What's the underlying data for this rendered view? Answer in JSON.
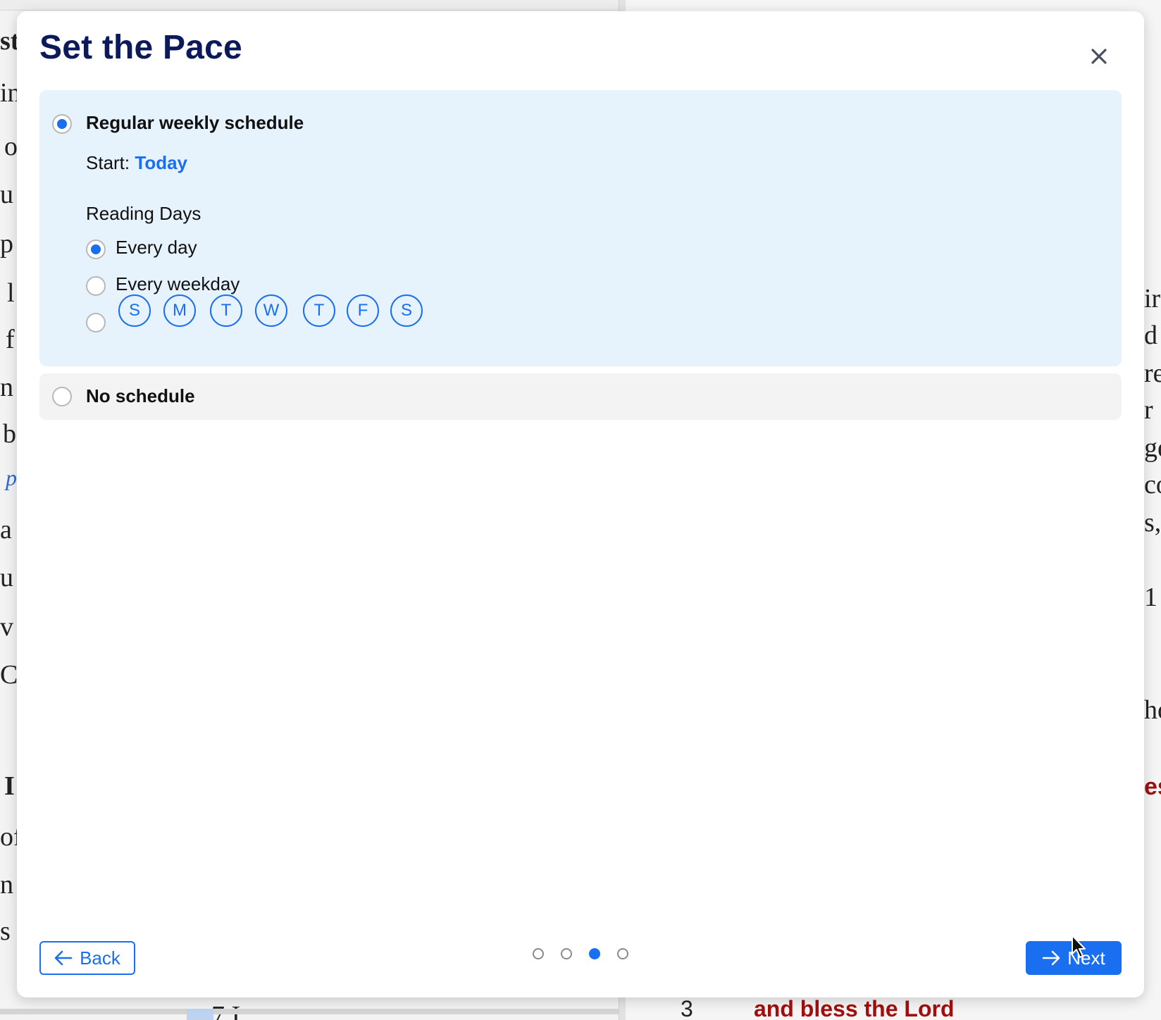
{
  "background": {
    "left_fragments": [
      "st",
      "in",
      "o",
      "u",
      "p",
      "l",
      "f",
      "n",
      "b",
      "p",
      "a",
      "u",
      "v",
      "C",
      "I",
      "of",
      "n",
      "s"
    ],
    "right_fragments": [
      "ir",
      "d",
      "re",
      "r",
      "ge",
      "co",
      "s,",
      "1",
      "ho",
      "es"
    ],
    "bottom_line_number": "3",
    "bottom_line_text": "and bless the Lord",
    "bottom_left_text": "7 I"
  },
  "modal": {
    "title": "Set the Pace",
    "close_icon": "close-icon",
    "options": {
      "regular": {
        "label": "Regular weekly schedule",
        "selected": true,
        "start_label": "Start:",
        "start_value": "Today",
        "reading_days_label": "Reading Days",
        "every_day": {
          "label": "Every day",
          "selected": true
        },
        "every_weekday": {
          "label": "Every weekday",
          "selected": false
        },
        "custom_days": {
          "selected": false,
          "days": [
            "S",
            "M",
            "T",
            "W",
            "T",
            "F",
            "S"
          ]
        }
      },
      "none": {
        "label": "No schedule",
        "selected": false
      }
    },
    "footer": {
      "back_label": "Back",
      "next_label": "Next",
      "back_icon": "arrow-left-icon",
      "next_icon": "arrow-right-icon",
      "step_current": 3,
      "step_total": 4
    }
  },
  "colors": {
    "accent": "#1a6ef0",
    "title": "#0c1a5c",
    "selected_card": "#e6f2fc",
    "unselected_card": "#f3f3f3"
  }
}
